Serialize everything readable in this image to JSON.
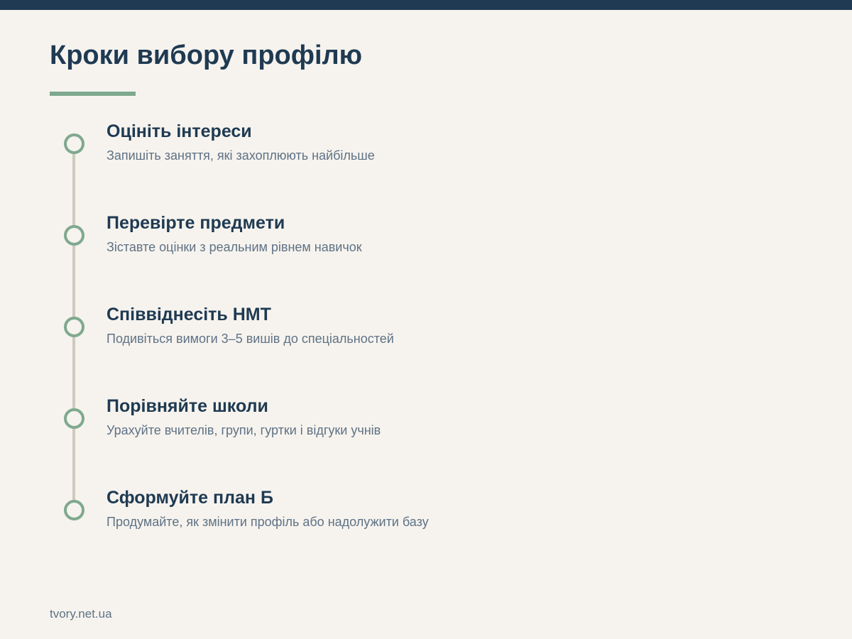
{
  "title": "Кроки вибору профілю",
  "steps": [
    {
      "title": "Оцініть інтереси",
      "desc": "Запишіть заняття, які захоплюють найбільше"
    },
    {
      "title": "Перевірте предмети",
      "desc": "Зіставте оцінки з реальним рівнем навичок"
    },
    {
      "title": "Співвіднесіть НМТ",
      "desc": "Подивіться вимоги 3–5 вишів до спеціальностей"
    },
    {
      "title": "Порівняйте школи",
      "desc": "Урахуйте вчителів, групи, гуртки і відгуки учнів"
    },
    {
      "title": "Сформуйте план Б",
      "desc": "Продумайте, як змінити профіль або надолужити базу"
    }
  ],
  "footer": "tvory.net.ua",
  "colors": {
    "primary": "#1f3a52",
    "accent": "#7fa98f",
    "background": "#f6f3ee",
    "muted_text": "#5f7285",
    "timeline": "#d1c9bd"
  }
}
